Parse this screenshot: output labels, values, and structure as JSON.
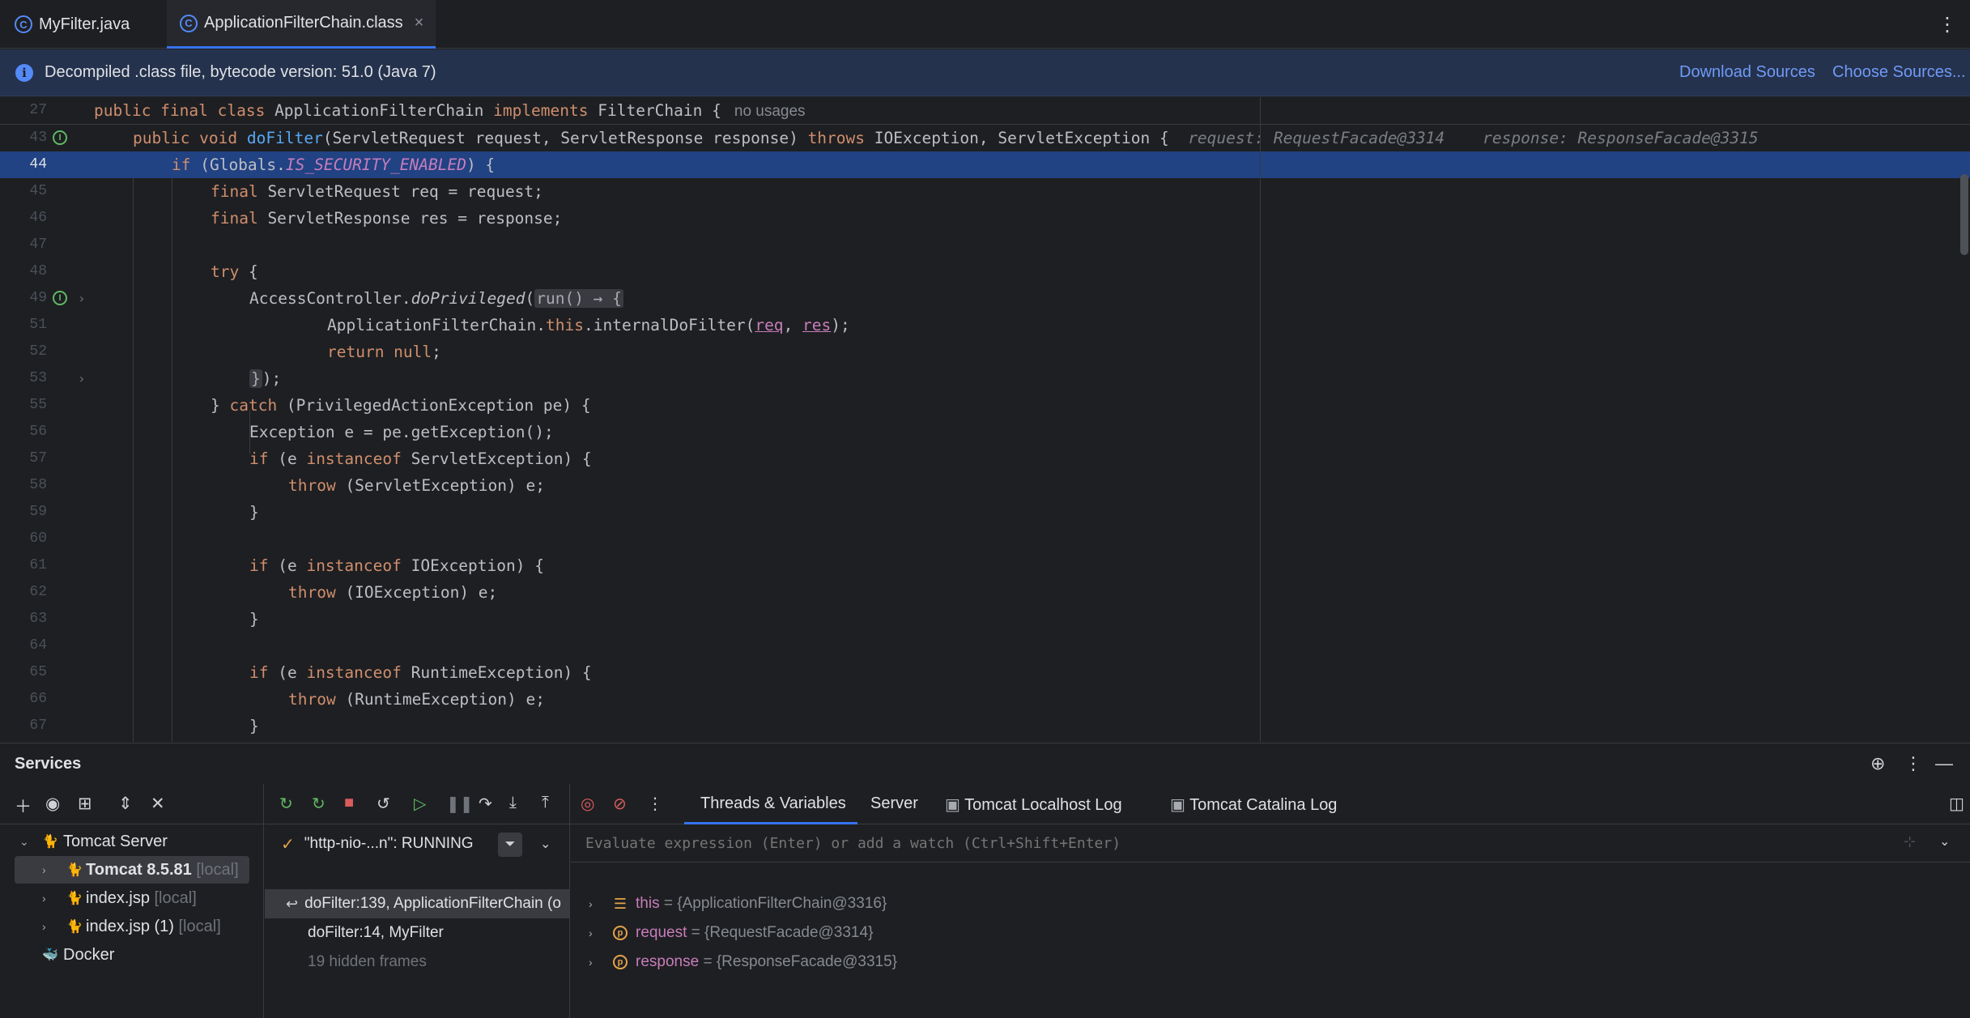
{
  "tabs": [
    {
      "label": "MyFilter.java",
      "active": false
    },
    {
      "label": "ApplicationFilterChain.class",
      "active": true
    }
  ],
  "banner": {
    "message": "Decompiled .class file, bytecode version: 51.0 (Java 7)",
    "download_sources": "Download Sources",
    "choose_sources": "Choose Sources..."
  },
  "editor": {
    "sticky_lines": [
      {
        "num": "27",
        "usages": "no usages"
      },
      {
        "num": "43",
        "hint_request": "request: RequestFacade@3314",
        "hint_response": "response: ResponseFacade@3315"
      }
    ],
    "lines": [
      {
        "num": "44"
      },
      {
        "num": "45"
      },
      {
        "num": "46"
      },
      {
        "num": "47"
      },
      {
        "num": "48"
      },
      {
        "num": "49"
      },
      {
        "num": "51"
      },
      {
        "num": "52"
      },
      {
        "num": "53"
      },
      {
        "num": "55"
      },
      {
        "num": "56"
      },
      {
        "num": "57"
      },
      {
        "num": "58"
      },
      {
        "num": "59"
      },
      {
        "num": "60"
      },
      {
        "num": "61"
      },
      {
        "num": "62"
      },
      {
        "num": "63"
      },
      {
        "num": "64"
      },
      {
        "num": "65"
      },
      {
        "num": "66"
      },
      {
        "num": "67"
      }
    ]
  },
  "services": {
    "title": "Services",
    "tree": [
      {
        "label": "Tomcat Server",
        "sub": ""
      },
      {
        "label": "Tomcat 8.5.81",
        "sub": "[local]"
      },
      {
        "label": "index.jsp",
        "sub": "[local]"
      },
      {
        "label": "index.jsp (1)",
        "sub": "[local]"
      },
      {
        "label": "Docker",
        "sub": ""
      }
    ],
    "debug_tabs": [
      "Threads & Variables",
      "Server",
      "Tomcat Localhost Log",
      "Tomcat Catalina Log"
    ],
    "thread": "\"http-nio-...n\": RUNNING",
    "frames": [
      {
        "label": "doFilter:139, ApplicationFilterChain (o"
      },
      {
        "label": "doFilter:14, MyFilter"
      },
      {
        "label": "19 hidden frames"
      }
    ],
    "eval_placeholder": "Evaluate expression (Enter) or add a watch (Ctrl+Shift+Enter)",
    "variables": [
      {
        "name": "this",
        "value": " = {ApplicationFilterChain@3316}"
      },
      {
        "name": "request",
        "value": " = {RequestFacade@3314}"
      },
      {
        "name": "response",
        "value": " = {ResponseFacade@3315}"
      }
    ]
  },
  "colors": {
    "accent": "#3574f0",
    "selection": "#214283",
    "keyword": "#cf8e6d",
    "function": "#56a8f5",
    "static_field": "#c77dbb"
  }
}
